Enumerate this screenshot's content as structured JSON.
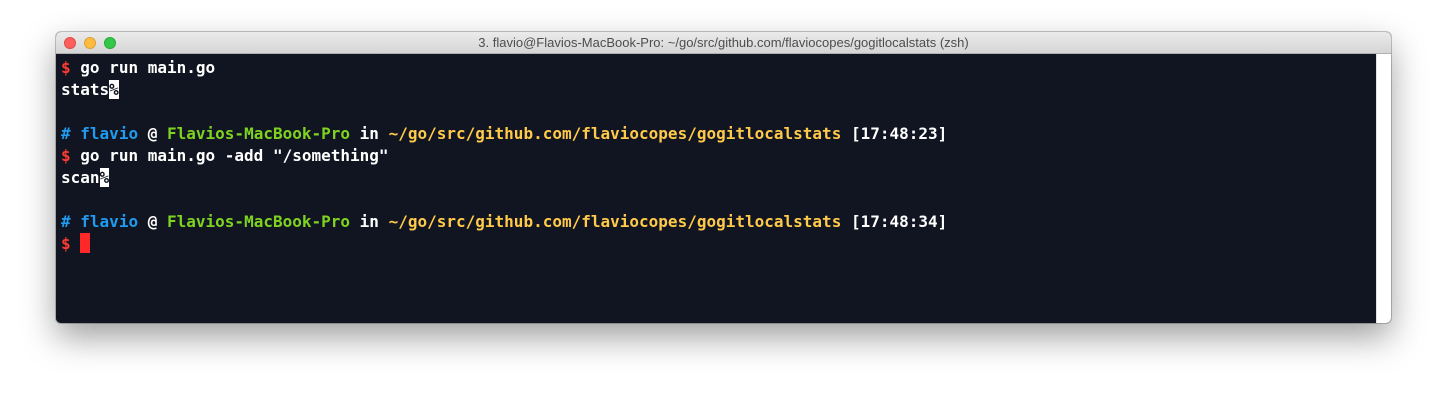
{
  "window": {
    "title": "3. flavio@Flavios-MacBook-Pro: ~/go/src/github.com/flaviocopes/gogitlocalstats (zsh)"
  },
  "colors": {
    "prompt_dollar": "#ff3b30",
    "hash_user": "#1f9bf0",
    "host": "#7ed321",
    "path": "#ffc94a",
    "background": "#111521",
    "cursor": "#ff2828"
  },
  "terminal": {
    "prompt_symbol": "$",
    "lines": [
      {
        "command": "go run main.go"
      },
      {
        "output": "stats",
        "end_marker": "%"
      },
      {
        "hash": "#",
        "user": "flavio",
        "at": "@",
        "host": "Flavios-MacBook-Pro",
        "in": "in",
        "path": "~/go/src/github.com/flaviocopes/gogitlocalstats",
        "time": "[17:48:23]"
      },
      {
        "command": "go run main.go -add \"/something\""
      },
      {
        "output": "scan",
        "end_marker": "%"
      },
      {
        "hash": "#",
        "user": "flavio",
        "at": "@",
        "host": "Flavios-MacBook-Pro",
        "in": "in",
        "path": "~/go/src/github.com/flaviocopes/gogitlocalstats",
        "time": "[17:48:34]"
      },
      {
        "command": ""
      }
    ]
  }
}
